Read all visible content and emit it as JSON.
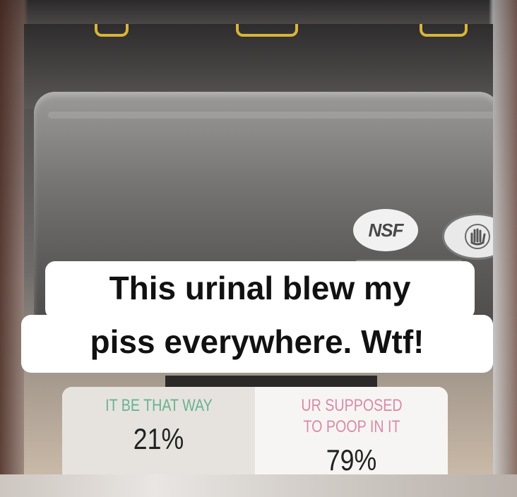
{
  "caption": {
    "line1": "This urinal blew my",
    "line2": "piss everywhere. Wtf!"
  },
  "logos": {
    "nsf": "NSF"
  },
  "poll": {
    "options": [
      {
        "label": "IT BE THAT WAY",
        "percent": "21%",
        "color": "#68b38f"
      },
      {
        "label": "UR SUPPOSED TO POOP IN IT",
        "percent": "79%",
        "color": "#d98aa8"
      }
    ]
  }
}
